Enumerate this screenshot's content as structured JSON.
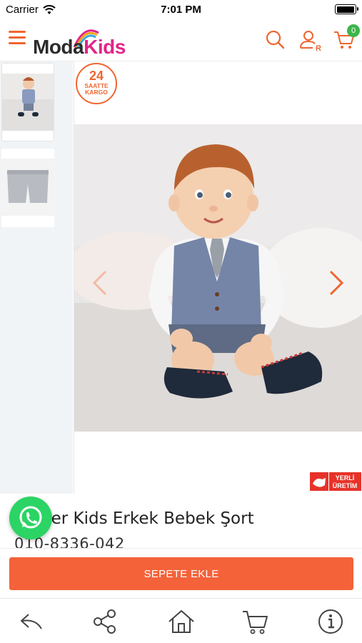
{
  "status_bar": {
    "carrier": "Carrier",
    "time": "7:01 PM"
  },
  "header": {
    "logo_moda": "Moda",
    "logo_kids": "Kids",
    "cart_count": "0",
    "brand_color": "#f0652f",
    "icons": [
      "menu-icon",
      "search-icon",
      "user-icon",
      "cart-icon"
    ]
  },
  "gallery": {
    "thumbnails": [
      "baby-outfit-thumbnail",
      "grey-shorts-thumbnail"
    ],
    "kargo_badge": {
      "number": "24",
      "line1": "SAATTE",
      "line2": "KARGO"
    },
    "yerli_badge": {
      "line1": "YERLİ",
      "line2": "ÜRETİM"
    }
  },
  "product": {
    "title": "der Kids Erkek Bebek Şort",
    "code": "010-8336-042"
  },
  "cart": {
    "add_label": "SEPETE EKLE",
    "button_color": "#f4623a"
  },
  "toolbar": {
    "icons": [
      "back-icon",
      "share-icon",
      "home-icon",
      "cart-icon",
      "info-icon"
    ]
  }
}
